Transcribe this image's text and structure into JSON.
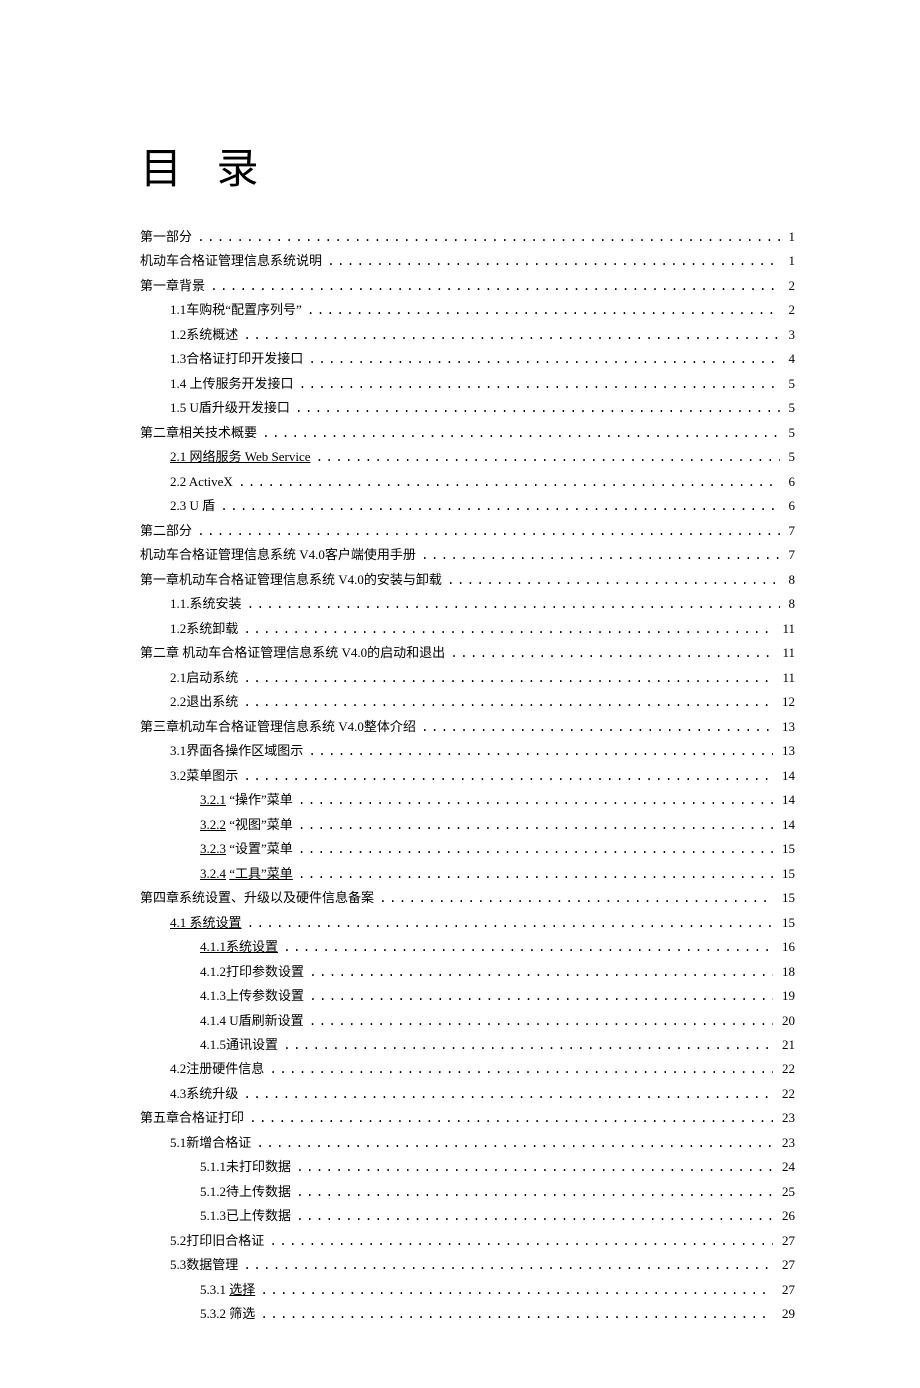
{
  "title": "目 录",
  "toc": [
    {
      "label": "第一部分",
      "page": "1",
      "indent": 0,
      "underline": false
    },
    {
      "label": "机动车合格证管理信息系统说明  ",
      "page": "1",
      "indent": 0,
      "underline": false
    },
    {
      "label": "第一章背景",
      "page": "2",
      "indent": 0,
      "underline": false
    },
    {
      "label": "1.1车购税“配置序列号” ",
      "page": "2",
      "indent": 1,
      "underline": false
    },
    {
      "label": "1.2系统概述",
      "page": "3",
      "indent": 1,
      "underline": false
    },
    {
      "label": "1.3合格证打印开发接口  ",
      "page": "4",
      "indent": 1,
      "underline": false
    },
    {
      "label": "1.4  上传服务开发接口  ",
      "page": "5",
      "indent": 1,
      "underline": false
    },
    {
      "label": "1.5  U盾升级开发接口  ",
      "page": "5",
      "indent": 1,
      "underline": false
    },
    {
      "label": "第二章相关技术概要",
      "page": "5",
      "indent": 0,
      "underline": false
    },
    {
      "label": "2.1  网络服务  Web Service ",
      "page": "5",
      "indent": 1,
      "underline": true
    },
    {
      "label": "2.2  ActiveX ",
      "page": "6",
      "indent": 1,
      "underline": false
    },
    {
      "label": "2.3  U 盾 ",
      "page": "6",
      "indent": 1,
      "underline": false
    },
    {
      "label": "第二部分",
      "page": "7",
      "indent": 0,
      "underline": false
    },
    {
      "label": "机动车合格证管理信息系统  V4.0客户端使用手册  ",
      "page": "7",
      "indent": 0,
      "underline": false
    },
    {
      "label": "第一章机动车合格证管理信息系统  V4.0的安装与卸载",
      "page": "8",
      "indent": 0,
      "underline": false
    },
    {
      "label": "1.1.系统安装  ",
      "page": "8",
      "indent": 1,
      "underline": false
    },
    {
      "label": "1.2系统卸载 ",
      "page": "11",
      "indent": 1,
      "underline": false
    },
    {
      "label": "第二章 机动车合格证管理信息系统  V4.0的启动和退出  ",
      "page": "11",
      "indent": 0,
      "underline": false
    },
    {
      "label": "2.1启动系统 ",
      "page": "11",
      "indent": 1,
      "underline": false
    },
    {
      "label": "2.2退出系统 ",
      "page": "12",
      "indent": 1,
      "underline": false
    },
    {
      "label": "第三章机动车合格证管理信息系统  V4.0整体介绍",
      "page": "13",
      "indent": 0,
      "underline": false
    },
    {
      "label": "3.1界面各操作区域图示  ",
      "page": "13",
      "indent": 1,
      "underline": false
    },
    {
      "label": "3.2菜单图示 ",
      "page": "14",
      "indent": 1,
      "underline": false
    },
    {
      "label": "3.2.1    “操作”菜单 ",
      "page": "14",
      "indent": 2,
      "underline": true,
      "underlineOnly": "3.2.1"
    },
    {
      "label": "3.2.2    “视图”菜单 ",
      "page": "14",
      "indent": 2,
      "underline": true,
      "underlineOnly": "3.2.2"
    },
    {
      "label": "3.2.3    “设置”菜单 ",
      "page": "15",
      "indent": 2,
      "underline": true,
      "underlineOnly": "3.2.3"
    },
    {
      "label": "3.2.4   “工具”菜单 ",
      "page": "15",
      "indent": 2,
      "underline": true,
      "underlineOnly": "3.2.4",
      "extraUnderline": "“工具”菜单"
    },
    {
      "label": "第四章系统设置、升级以及硬件信息备案  ",
      "page": "15",
      "indent": 0,
      "underline": false
    },
    {
      "label": "4.1 系统设置  ",
      "page": "15",
      "indent": 1,
      "underline": true,
      "underlineOnly": "4.1 系统设置"
    },
    {
      "label": "4.1.1系统设置 ",
      "page": "16",
      "indent": 2,
      "underline": true,
      "underlineOnly": "4.1.1系统设置"
    },
    {
      "label": "4.1.2打印参数设置  ",
      "page": "18",
      "indent": 2,
      "underline": false
    },
    {
      "label": "4.1.3上传参数设置  ",
      "page": "19",
      "indent": 2,
      "underline": false
    },
    {
      "label": "4.1.4  U盾刷新设置",
      "page": "20",
      "indent": 2,
      "underline": false
    },
    {
      "label": "4.1.5通讯设置 ",
      "page": "21",
      "indent": 2,
      "underline": false
    },
    {
      "label": "4.2注册硬件信息  ",
      "page": "22",
      "indent": 1,
      "underline": false
    },
    {
      "label": "4.3系统升级 ",
      "page": "22",
      "indent": 1,
      "underline": false
    },
    {
      "label": "第五章合格证打印",
      "page": "23",
      "indent": 0,
      "underline": false
    },
    {
      "label": "5.1新增合格证  ",
      "page": "23",
      "indent": 1,
      "underline": false
    },
    {
      "label": "5.1.1未打印数据  ",
      "page": "24",
      "indent": 2,
      "underline": false
    },
    {
      "label": "5.1.2待上传数据  ",
      "page": "25",
      "indent": 2,
      "underline": false
    },
    {
      "label": "5.1.3已上传数据  ",
      "page": "26",
      "indent": 2,
      "underline": false
    },
    {
      "label": "5.2打印旧合格证  ",
      "page": "27",
      "indent": 1,
      "underline": false
    },
    {
      "label": "5.3数据管理 ",
      "page": "27",
      "indent": 1,
      "underline": false
    },
    {
      "label": "5.3.1   选择 ",
      "page": "27",
      "indent": 2,
      "underline": true,
      "underlineOnly": "选择"
    },
    {
      "label": "5.3.2   筛选 ",
      "page": "29",
      "indent": 2,
      "underline": false
    }
  ]
}
